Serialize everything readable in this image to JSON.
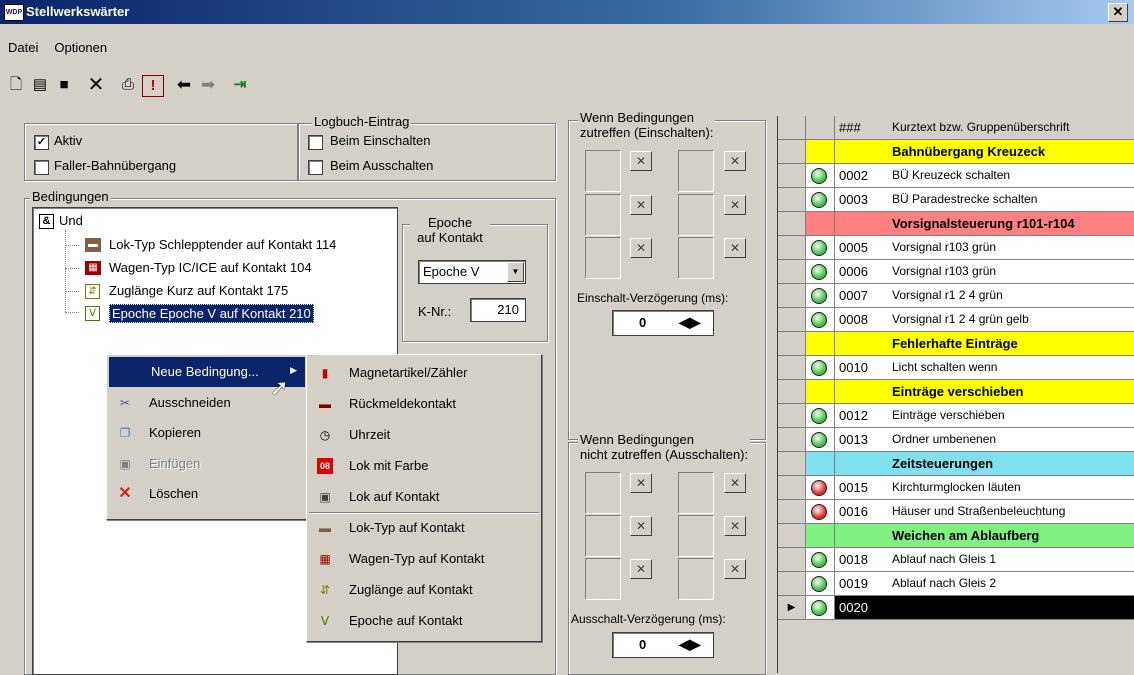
{
  "window": {
    "title": "Stellwerkswärter",
    "app_icon": "WDP",
    "close": "✕"
  },
  "menu": [
    "Datei",
    "Optionen"
  ],
  "toolbar": {
    "icons": [
      "new-icon",
      "open-icon",
      "save-icon",
      "delete-icon",
      "print-icon",
      "alert-icon",
      "back-icon",
      "forward-icon",
      "exit-icon"
    ]
  },
  "options": {
    "aktiv_label": "Aktiv",
    "aktiv_checked": true,
    "faller_label": "Faller-Bahnübergang",
    "faller_checked": false
  },
  "logbuch": {
    "title": "Logbuch-Eintrag",
    "einschalten": "Beim Einschalten",
    "ausschalten": "Beim Ausschalten"
  },
  "bedingungen": {
    "title": "Bedingungen",
    "root": "Und",
    "items": [
      "Lok-Typ Schlepptender auf Kontakt 114",
      "Wagen-Typ IC/ICE auf Kontakt 104",
      "Zuglänge Kurz auf Kontakt 175",
      "Epoche Epoche V auf Kontakt 210"
    ]
  },
  "epoche": {
    "title_line1": "Epoche",
    "title_line2": "auf Kontakt",
    "selected": "Epoche V",
    "knr_label": "K-Nr.:",
    "knr_value": "210"
  },
  "einschalten": {
    "title_line1": "Wenn Bedingungen",
    "title_line2": "zutreffen (Einschalten):",
    "delay_label": "Einschalt-Verzögerung (ms):",
    "delay_value": "0"
  },
  "ausschalten": {
    "title_line1": "Wenn Bedingungen",
    "title_line2": "nicht zutreffen (Ausschalten):",
    "delay_label": "Ausschalt-Verzögerung (ms):",
    "delay_value": "0"
  },
  "context_menu": [
    {
      "label": "Neue Bedingung...",
      "icon": "new-condition",
      "enabled": true,
      "submenu": true
    },
    {
      "label": "Ausschneiden",
      "icon": "scissors-icon",
      "enabled": true
    },
    {
      "label": "Kopieren",
      "icon": "copy-icon",
      "enabled": true
    },
    {
      "label": "Einfügen",
      "icon": "paste-icon",
      "enabled": false
    },
    {
      "label": "Löschen",
      "icon": "delete-x-icon",
      "enabled": true
    }
  ],
  "submenu": [
    {
      "label": "Magnetartikel/Zähler",
      "icon": "signal-icon"
    },
    {
      "label": "Rückmeldekontakt",
      "icon": "contact-icon"
    },
    {
      "label": "Uhrzeit",
      "icon": "clock-icon"
    },
    {
      "label": "Lok mit Farbe",
      "icon": "color-loco-icon",
      "icon_text": "08"
    },
    {
      "label": "Lok auf Kontakt",
      "icon": "loco-icon"
    },
    {
      "label": "Lok-Typ auf Kontakt",
      "icon": "loco-type-icon"
    },
    {
      "label": "Wagen-Typ auf Kontakt",
      "icon": "wagon-type-icon"
    },
    {
      "label": "Zuglänge auf Kontakt",
      "icon": "train-length-icon"
    },
    {
      "label": "Epoche auf Kontakt",
      "icon": "epoch-icon"
    }
  ],
  "table": {
    "col_num": "###",
    "col_text": "Kurztext bzw. Gruppenüberschrift",
    "rows": [
      {
        "type": "group",
        "text": "Bahnübergang Kreuzeck",
        "color": "#ffff00"
      },
      {
        "type": "item",
        "num": "0002",
        "text": "BÜ Kreuzeck schalten",
        "lamp": "green"
      },
      {
        "type": "item",
        "num": "0003",
        "text": "BÜ Paradestrecke schalten",
        "lamp": "green"
      },
      {
        "type": "group",
        "text": "Vorsignalsteuerung r101-r104",
        "color": "#ff8080"
      },
      {
        "type": "item",
        "num": "0005",
        "text": "Vorsignal r103 grün",
        "lamp": "green"
      },
      {
        "type": "item",
        "num": "0006",
        "text": "Vorsignal r103 grün",
        "lamp": "green"
      },
      {
        "type": "item",
        "num": "0007",
        "text": "Vorsignal r1 2 4 grün",
        "lamp": "green"
      },
      {
        "type": "item",
        "num": "0008",
        "text": "Vorsignal r1 2 4 grün gelb",
        "lamp": "green"
      },
      {
        "type": "group",
        "text": "Fehlerhafte Einträge",
        "color": "#ffff00"
      },
      {
        "type": "item",
        "num": "0010",
        "text": "Licht schalten wenn",
        "lamp": "green"
      },
      {
        "type": "group",
        "text": "Einträge verschieben",
        "color": "#ffff00"
      },
      {
        "type": "item",
        "num": "0012",
        "text": "Einträge verschieben",
        "lamp": "green"
      },
      {
        "type": "item",
        "num": "0013",
        "text": "Ordner umbenenen",
        "lamp": "green"
      },
      {
        "type": "group",
        "text": "Zeitsteuerungen",
        "color": "#80e0f0"
      },
      {
        "type": "item",
        "num": "0015",
        "text": "Kirchturmglocken läuten",
        "lamp": "red"
      },
      {
        "type": "item",
        "num": "0016",
        "text": "Häuser und Straßenbeleuchtung",
        "lamp": "red"
      },
      {
        "type": "group",
        "text": "Weichen am Ablaufberg",
        "color": "#80f080"
      },
      {
        "type": "item",
        "num": "0018",
        "text": "Ablauf nach Gleis 1",
        "lamp": "green"
      },
      {
        "type": "item",
        "num": "0019",
        "text": "Ablauf nach Gleis 2",
        "lamp": "green"
      },
      {
        "type": "current",
        "num": "0020",
        "text": "",
        "lamp": "green"
      }
    ]
  },
  "colors": {
    "title_bar": "#0a246a",
    "selection": "#0a246a",
    "lamp_green": "#44c444",
    "lamp_red": "#e03030"
  }
}
